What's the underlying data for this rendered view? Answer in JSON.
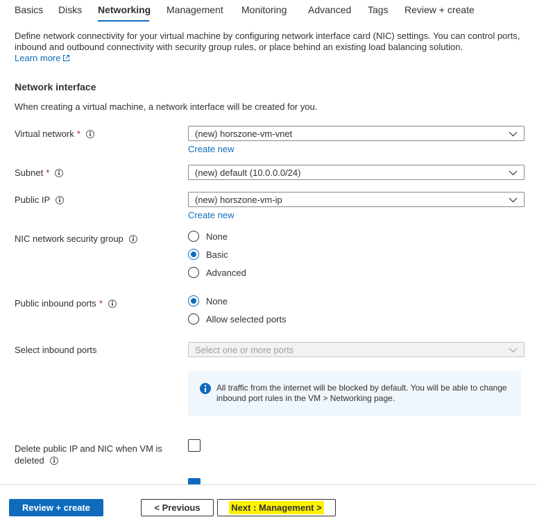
{
  "tabs": [
    {
      "label": "Basics",
      "active": false
    },
    {
      "label": "Disks",
      "active": false
    },
    {
      "label": "Networking",
      "active": true
    },
    {
      "label": "Management",
      "active": false
    },
    {
      "label": "Monitoring",
      "active": false
    },
    {
      "label": "Advanced",
      "active": false
    },
    {
      "label": "Tags",
      "active": false
    },
    {
      "label": "Review + create",
      "active": false
    }
  ],
  "intro": {
    "description": "Define network connectivity for your virtual machine by configuring network interface card (NIC) settings. You can control ports, inbound and outbound connectivity with security group rules, or place behind an existing load balancing solution.",
    "learn_more": "Learn more"
  },
  "network_interface": {
    "title": "Network interface",
    "note": "When creating a virtual machine, a network interface will be created for you."
  },
  "fields": {
    "virtual_network": {
      "label": "Virtual network",
      "required": "*",
      "value": "(new) horszone-vm-vnet",
      "create_new": "Create new"
    },
    "subnet": {
      "label": "Subnet",
      "required": "*",
      "value": "(new) default (10.0.0.0/24)"
    },
    "public_ip": {
      "label": "Public IP",
      "value": "(new) horszone-vm-ip",
      "create_new": "Create new"
    },
    "nic_nsg": {
      "label": "NIC network security group",
      "options": [
        "None",
        "Basic",
        "Advanced"
      ],
      "selected": "Basic"
    },
    "public_inbound_ports": {
      "label": "Public inbound ports",
      "required": "*",
      "options": [
        "None",
        "Allow selected ports"
      ],
      "selected": "None"
    },
    "select_inbound_ports": {
      "label": "Select inbound ports",
      "placeholder": "Select one or more ports"
    },
    "info_message": "All traffic from the internet will be blocked by default. You will be able to change inbound port rules in the VM > Networking page.",
    "delete_ip_nic": {
      "label_line1": "Delete public IP and NIC when VM is",
      "label_line2": "deleted",
      "checked": false
    },
    "accelerated_networking": {
      "checked": true
    }
  },
  "footer": {
    "review_create": "Review + create",
    "previous": "< Previous",
    "next": "Next : Management >"
  },
  "colors": {
    "accent": "#0f6cbd",
    "highlight": "#fff200",
    "required": "#a4262c",
    "info_bg": "#eff6fc"
  }
}
